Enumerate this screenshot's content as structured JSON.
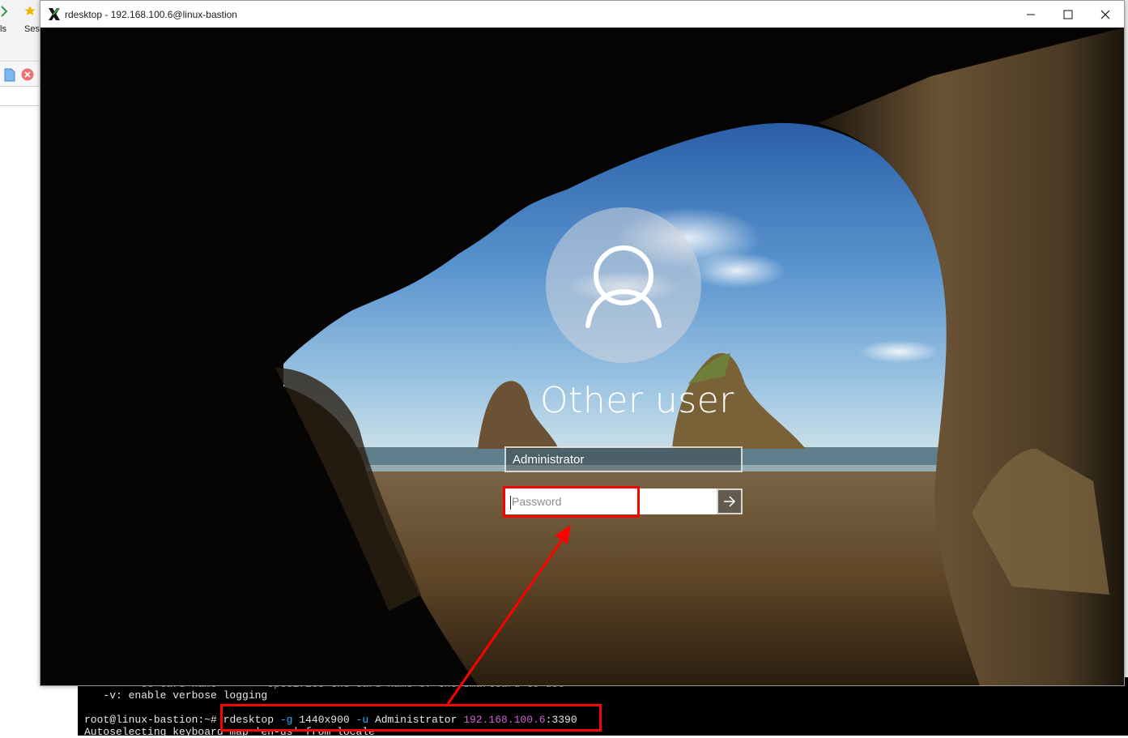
{
  "host_app": {
    "toolbar_labels": [
      "ls",
      "Sess"
    ]
  },
  "window": {
    "title": "rdesktop - 192.168.100.6@linux-bastion",
    "controls": [
      "minimize",
      "maximize",
      "close"
    ]
  },
  "login": {
    "heading": "Other user",
    "username_value": "Administrator",
    "password_placeholder": "Password",
    "submit_icon": "arrow-right-icon"
  },
  "terminal": {
    "partial_line": "         sc card name        specifies the card name of the smartcard to use",
    "help_line": "   -v: enable verbose logging",
    "prompt": "root@linux-bastion:~#",
    "cmd": "rdesktop",
    "opt_g": "-g",
    "geometry": "1440x900",
    "opt_u": "-u",
    "user": "Administrator",
    "ip": "192.168.100.6",
    "port": ":3390",
    "output_line": "Autoselecting keyboard map 'en-us' from locale"
  },
  "colors": {
    "annotation": "#ff0000",
    "terminal_option": "#2fb0ff",
    "terminal_ip": "#d45fd4"
  }
}
